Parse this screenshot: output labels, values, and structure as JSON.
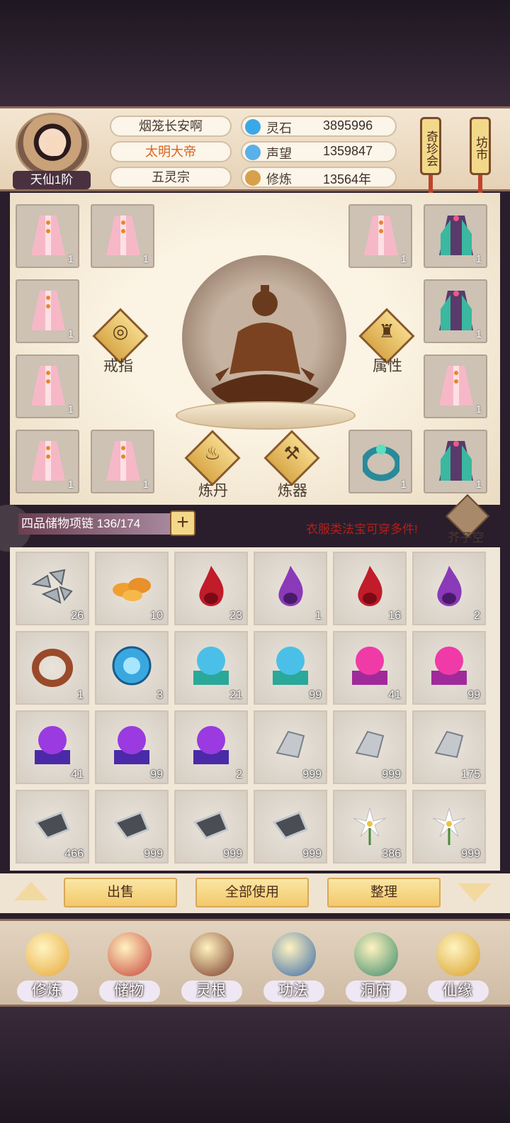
{
  "header": {
    "rank": "天仙1阶",
    "player_name": "烟笼长安啊",
    "title": "太明大帝",
    "sect": "五灵宗",
    "stats": [
      {
        "label": "灵石",
        "value": "3895996",
        "icon": "spirit-stone-icon"
      },
      {
        "label": "声望",
        "value": "1359847",
        "icon": "reputation-icon"
      },
      {
        "label": "修炼",
        "value": "13564年",
        "icon": "cultivation-icon"
      }
    ],
    "scroll_left": "奇珍会",
    "scroll_right": "坊市"
  },
  "equip": {
    "ring_label": "戒指",
    "attr_label": "属性",
    "alchemy_label": "炼丹",
    "forge_label": "炼器",
    "slot_count": "1"
  },
  "bag": {
    "title": "四品储物项链 136/174",
    "plus": "+",
    "hint": "衣服类法宝可穿多件!",
    "space_label": "芥子空间"
  },
  "items": [
    {
      "name": "iron-shards",
      "count": "26"
    },
    {
      "name": "gold-ore",
      "count": "10"
    },
    {
      "name": "red-flame",
      "count": "23"
    },
    {
      "name": "purple-flame",
      "count": "1"
    },
    {
      "name": "red-flame",
      "count": "16"
    },
    {
      "name": "purple-flame",
      "count": "2"
    },
    {
      "name": "wooden-ring",
      "count": "1"
    },
    {
      "name": "blue-orb",
      "count": "3"
    },
    {
      "name": "teal-pedestal-orb",
      "count": "21"
    },
    {
      "name": "teal-pedestal-orb",
      "count": "99"
    },
    {
      "name": "pink-pedestal-orb",
      "count": "41"
    },
    {
      "name": "pink-pedestal-orb",
      "count": "99"
    },
    {
      "name": "purple-pedestal-orb",
      "count": "41"
    },
    {
      "name": "purple-pedestal-orb",
      "count": "99"
    },
    {
      "name": "purple-pedestal-orb",
      "count": "2"
    },
    {
      "name": "silver-ore",
      "count": "999"
    },
    {
      "name": "silver-ore",
      "count": "999"
    },
    {
      "name": "silver-ore",
      "count": "175"
    },
    {
      "name": "dark-ore",
      "count": "466"
    },
    {
      "name": "dark-ore",
      "count": "999"
    },
    {
      "name": "dark-ore",
      "count": "999"
    },
    {
      "name": "dark-ore",
      "count": "999"
    },
    {
      "name": "white-lily",
      "count": "386"
    },
    {
      "name": "white-lily",
      "count": "999"
    }
  ],
  "actions": {
    "sell": "出售",
    "use_all": "全部使用",
    "arrange": "整理"
  },
  "nav": [
    {
      "label": "修炼",
      "icon": "cultivate-icon",
      "color": "#e6a83a"
    },
    {
      "label": "储物",
      "icon": "storage-bag-icon",
      "color": "#c8433a"
    },
    {
      "label": "灵根",
      "icon": "spirit-root-icon",
      "color": "#7a3a2a"
    },
    {
      "label": "功法",
      "icon": "technique-book-icon",
      "color": "#3a6aa8"
    },
    {
      "label": "洞府",
      "icon": "cave-mansion-icon",
      "color": "#3a8a6a"
    },
    {
      "label": "仙缘",
      "icon": "immortal-fate-icon",
      "color": "#d8a02a"
    }
  ]
}
